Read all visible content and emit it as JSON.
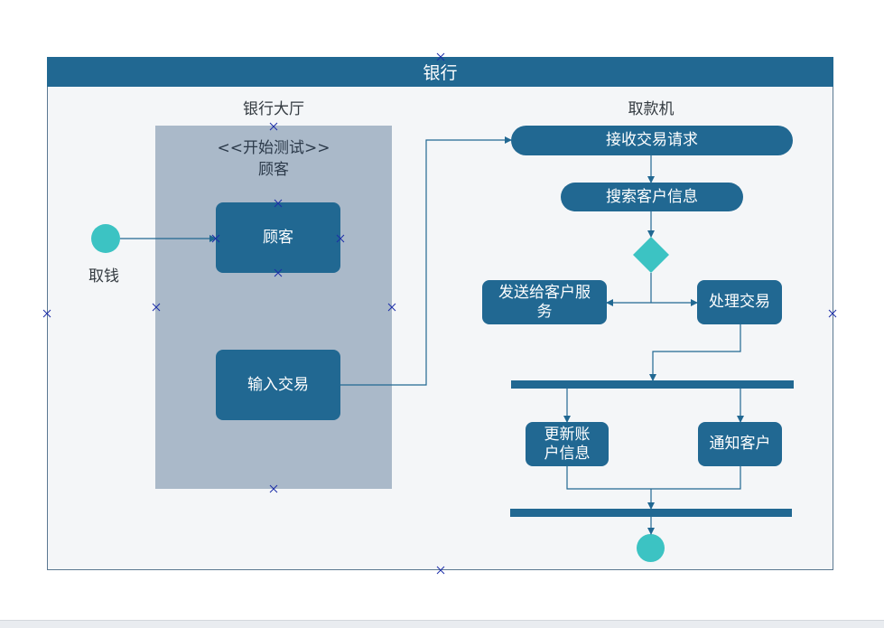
{
  "pool": {
    "title": "银行"
  },
  "lanes": {
    "hall": {
      "title": "银行大厅"
    },
    "atm": {
      "title": "取款机"
    }
  },
  "customer_box": {
    "stereotype": "<<开始测试>>",
    "name": "顾客"
  },
  "start": {
    "label": "取钱"
  },
  "nodes": {
    "customer": "顾客",
    "input_transaction": "输入交易",
    "receive_request": "接收交易请求",
    "search_customer": "搜索客户信息",
    "send_service": "发送给客户服务",
    "process_transaction": "处理交易",
    "update_account": "更新账户信息",
    "notify_customer": "通知客户"
  },
  "colors": {
    "node_fill": "#216892",
    "lane_fill": "#aab9c9",
    "initial_final": "#3cc3c3",
    "decision": "#3cc3c3",
    "connector": "#216892"
  }
}
